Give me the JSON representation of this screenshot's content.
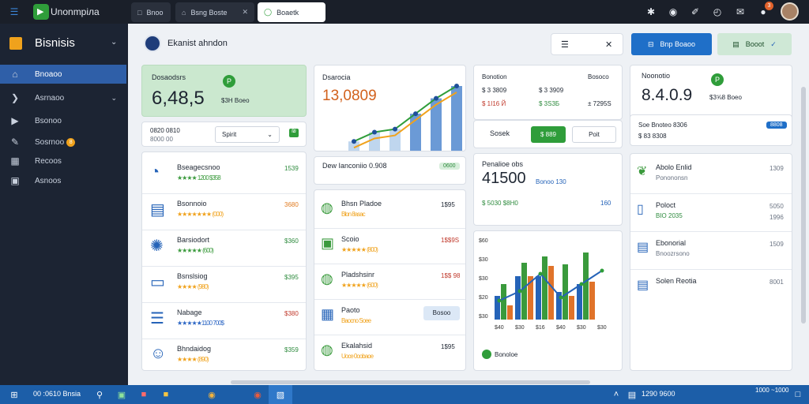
{
  "window": {
    "app_name": "Unonmpiлa",
    "tabs": [
      {
        "label": "Bnoo"
      },
      {
        "label": "Bsng Boste"
      },
      {
        "label": "Boaetk"
      }
    ],
    "notification_badge": "3"
  },
  "sidebar": {
    "title": "Bisnisis",
    "items": [
      {
        "label": "Bnoaoo",
        "icon": "home-icon"
      },
      {
        "label": "Asrnaoo",
        "icon": "chevron-icon"
      },
      {
        "label": "Bsonoo",
        "icon": "play-icon"
      },
      {
        "label": "Sosrnoo",
        "icon": "pencil-icon",
        "badge": "8"
      },
      {
        "label": "Recoos",
        "icon": "grid-icon"
      },
      {
        "label": "Asnoos",
        "icon": "layers-icon"
      }
    ]
  },
  "header": {
    "title": "Ekanist ahndon",
    "primary_button": "Bnp Boaoo",
    "secondary_button": "Booot"
  },
  "stat_card_1": {
    "label": "Dosaodsrs",
    "value": "6,48,5",
    "sub": "$3H Boeo",
    "badge": "P"
  },
  "filter": {
    "text": "0820 0810",
    "sub": "8000 00",
    "select": "Spirit",
    "badge": "₪"
  },
  "chart_card_1": {
    "title": "Dsarocia",
    "value": "13,0809",
    "chart_data": {
      "type": "area",
      "values": [
        10,
        25,
        30,
        55,
        80,
        100
      ]
    }
  },
  "stats_table": {
    "header": [
      "Bonotion",
      "Bosoco"
    ],
    "rows": [
      [
        "$ 3 3809",
        "$ 3 3909"
      ],
      [
        "$ 1I16 Й",
        "$ 3S3Б"
      ],
      [
        "",
        "± 7295S"
      ]
    ]
  },
  "action_row": {
    "label": "Sosek",
    "primary": "$ 889",
    "secondary": "Poit"
  },
  "stat_card_2": {
    "label": "Noonotio",
    "value": "8.4.0.9",
    "sub": "$3⅝8 Boeo",
    "badge": "P"
  },
  "stat_card_2_footer": {
    "label": "Soe Bnoteo 8306",
    "sub": "$ 83 8308",
    "chip": "8808"
  },
  "product_list": [
    {
      "name": "Bseagecsnoo",
      "price": "1539",
      "rating": "★★★★ 1200 $358",
      "icon": "pie-icon"
    },
    {
      "name": "Bsonnoio",
      "price": "3680",
      "rating": "★★★★★★★ (000)",
      "icon": "table-icon"
    },
    {
      "name": "Barsiodort",
      "price": "$360",
      "rating": "★★★★★ (600)",
      "icon": "star-burst-icon"
    },
    {
      "name": "Bsnslsiog",
      "price": "$395",
      "rating": "★★★★ (980)",
      "icon": "clipboard-icon"
    },
    {
      "name": "Nabage",
      "price": "$380",
      "rating": "★★★★★1100 700$",
      "icon": "list-icon"
    },
    {
      "name": "Bhndaidog",
      "price": "$359",
      "rating": "★★★★ (890)",
      "icon": "smile-icon"
    }
  ],
  "middle_summary": {
    "label": "Dew Ianconiio 0.908",
    "chip": "0600"
  },
  "middle_list": [
    {
      "name": "Bhsn Pladoe",
      "price": "1$95",
      "rating": "Blon 8asac",
      "icon": "bag-icon"
    },
    {
      "name": "Scoio",
      "price": "1$$9S",
      "rating": "★★★★★ (800)",
      "icon": "box-icon"
    },
    {
      "name": "Pladshsinr",
      "price": "1$$ 98",
      "rating": "★★★★★ (600)",
      "icon": "bag-icon"
    },
    {
      "name": "Paoto",
      "price": "",
      "rating": "Baocno Soee",
      "icon": "cart-icon",
      "button": "Bosoo"
    },
    {
      "name": "Ekalahsid",
      "price": "1$95",
      "rating": "Uoce 0oobaoe",
      "icon": "bag-icon"
    }
  ],
  "kpi_card": {
    "label": "Penalioe obs",
    "value": "41500",
    "sub": "Bonoo 130",
    "foot": "$ 5030 $8H0",
    "foot_right": "160"
  },
  "bar_chart": {
    "yticks": [
      "$60",
      "$30",
      "$30",
      "$20",
      "$30"
    ],
    "xticks": [
      "$40",
      "$30",
      "$16",
      "$40",
      "$30",
      "$30"
    ],
    "legend": "Bonoloe",
    "chart_data": {
      "type": "bar",
      "categories": [
        "$40",
        "$30",
        "$16",
        "$40",
        "$30",
        "$30"
      ],
      "series": [
        {
          "values": [
            30,
            55,
            55,
            35,
            45
          ]
        },
        {
          "values": [
            45,
            72,
            80,
            70,
            85
          ]
        },
        {
          "values": [
            18,
            55,
            68,
            30,
            48
          ]
        }
      ],
      "line": [
        24,
        36,
        58,
        28,
        45,
        62
      ]
    }
  },
  "right_list": [
    {
      "name": "Abolo Enlid",
      "sub": "Ponononsn",
      "value": "1309",
      "icon": "leaf-icon"
    },
    {
      "name": "Poloct",
      "sub": "BIO 2035",
      "value": "5050",
      "value2": "1996",
      "icon": "phone-icon"
    },
    {
      "name": "Ebonorial",
      "sub": "Bnoozrsono",
      "value": "1509",
      "icon": "doc-icon"
    },
    {
      "name": "Solen Reotia",
      "sub": "",
      "value": "8001",
      "icon": "doc-icon"
    }
  ],
  "taskbar": {
    "search": "00 :0610 Bnsia",
    "clock": "1290 9600",
    "date": "1000 ~1000"
  }
}
